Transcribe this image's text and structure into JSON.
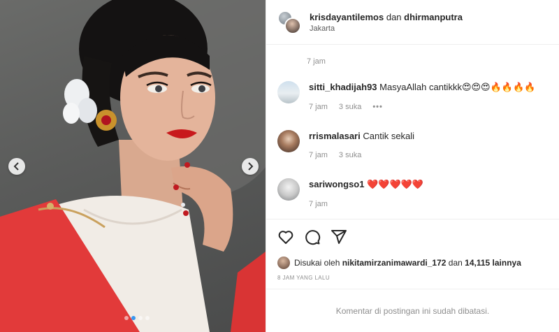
{
  "header": {
    "user1": "krisdayantilemos",
    "joiner": "dan",
    "user2": "dhirmanputra",
    "location": "Jakarta"
  },
  "comments": [
    {
      "time": "7 jam"
    },
    {
      "user": "sitti_khadijah93",
      "text": "MasyaAllah cantikkk",
      "emoji": "😍😍😍🔥🔥🔥🔥",
      "time": "7 jam",
      "likes": "3 suka",
      "more": "•••"
    },
    {
      "user": "rrismalasari",
      "text": "Cantik sekali",
      "time": "7 jam",
      "likes": "3 suka"
    },
    {
      "user": "sariwongso1",
      "text": "",
      "emoji": "❤️❤️❤️❤️❤️",
      "time": "7 jam"
    }
  ],
  "likes": {
    "prefix": "Disukai oleh",
    "user": "nikitamirzanimawardi_172",
    "joiner": "dan",
    "count": "14,115 lainnya"
  },
  "timestamp": "8 JAM YANG LALU",
  "disabled_notice": "Komentar di postingan ini sudah dibatasi.",
  "icons": {
    "like": "heart-icon",
    "comment": "comment-icon",
    "share": "share-icon",
    "prev": "chevron-left-icon",
    "next": "chevron-right-icon"
  },
  "colors": {
    "text": "#262626",
    "muted": "#8e8e8e",
    "border": "#efefef",
    "accent": "#3897f0",
    "sash": "#e23a3a"
  },
  "carousel": {
    "total": 4,
    "active": 1
  }
}
